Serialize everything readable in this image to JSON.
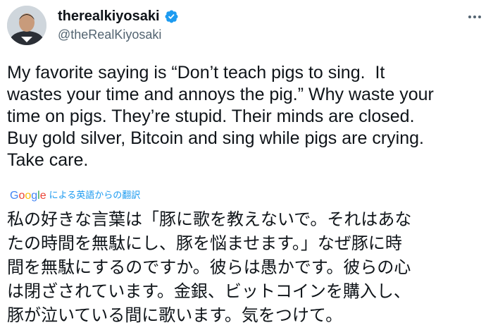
{
  "author": {
    "display_name": "therealkiyosaki",
    "handle": "@theRealKiyosaki",
    "verified": true,
    "avatar": "profile-photo"
  },
  "tweet": {
    "text": "My favorite saying is “Don’t teach pigs to sing.  It\nwastes your time and annoys the pig.” Why waste your\ntime on pigs. They’re stupid. Their minds are closed.\nBuy gold silver, Bitcoin and sing while pigs are crying.\nTake care."
  },
  "translation": {
    "provider": "Google",
    "label": "による英語からの翻訳",
    "text": "私の好きな言葉は「豚に歌を教えないで。それはあな\nたの時間を無駄にし、豚を悩ませます。」なぜ豚に時\n間を無駄にするのですか。彼らは愚かです。彼らの心\nは閉ざされています。金銀、ビットコインを購入し、\n豚が泣いている間に歌います。気をつけて。"
  },
  "colors": {
    "verified_badge": "#1d9bf0",
    "link": "#1d9bf0",
    "secondary_text": "#536471"
  },
  "icons": [
    "verified-badge-icon",
    "more-options-icon",
    "google-logo"
  ]
}
